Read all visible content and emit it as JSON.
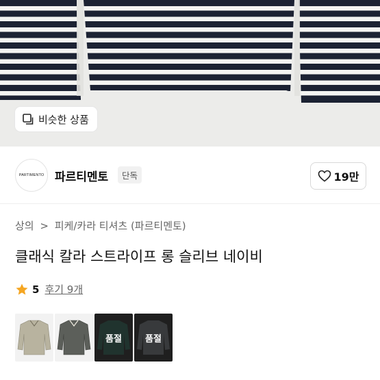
{
  "similar_button": {
    "label": "비슷한 상품",
    "icon": "similar-items-icon"
  },
  "brand": {
    "logo_text": "PARTIMENTO",
    "name": "파르티멘토",
    "badge": "단독"
  },
  "like": {
    "count": "19만",
    "icon": "heart-icon"
  },
  "breadcrumb": {
    "level1": "상의",
    "separator": ">",
    "level2": "피케/카라 티셔츠 (파르티멘토)"
  },
  "product": {
    "title": "클래식 칼라 스트라이프 롱 슬리브 네이비"
  },
  "rating": {
    "score": "5",
    "reviews": "후기 9개",
    "star_color": "#f5a623"
  },
  "variants": [
    {
      "name": "beige",
      "sold_out": false,
      "label": ""
    },
    {
      "name": "charcoal",
      "sold_out": false,
      "label": ""
    },
    {
      "name": "dark-green",
      "sold_out": true,
      "label": "품절"
    },
    {
      "name": "grey",
      "sold_out": true,
      "label": "품절"
    }
  ],
  "colors": {
    "stripe_navy": "#1c2233",
    "stripe_white": "#f4f4f2",
    "hero_bg": "#ececea"
  }
}
